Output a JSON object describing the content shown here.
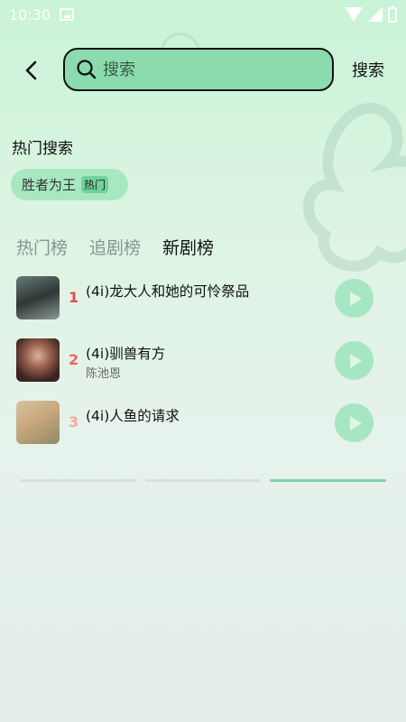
{
  "status_bar": {
    "time": "10:30"
  },
  "header": {
    "search_placeholder": "搜索",
    "search_button": "搜索"
  },
  "hot_search": {
    "title": "热门搜索",
    "chips": [
      {
        "text": "胜者为王",
        "badge": "热门"
      }
    ]
  },
  "tabs": [
    {
      "label": "热门榜",
      "active": false
    },
    {
      "label": "追剧榜",
      "active": false
    },
    {
      "label": "新剧榜",
      "active": true
    }
  ],
  "list": [
    {
      "rank": "1",
      "title": "(4i)龙大人和她的可怜祭品",
      "subtitle": ""
    },
    {
      "rank": "2",
      "title": "(4i)驯兽有方",
      "subtitle": "陈池恩"
    },
    {
      "rank": "3",
      "title": "(4i)人鱼的请求",
      "subtitle": ""
    }
  ],
  "colors": {
    "accent": "#8bdbae",
    "rank_1": "#e84a4a",
    "rank_2": "#ef6262",
    "rank_3": "#f0a99a"
  },
  "icons": {
    "back": "chevron-left-icon",
    "search": "search-icon",
    "play": "play-icon"
  }
}
